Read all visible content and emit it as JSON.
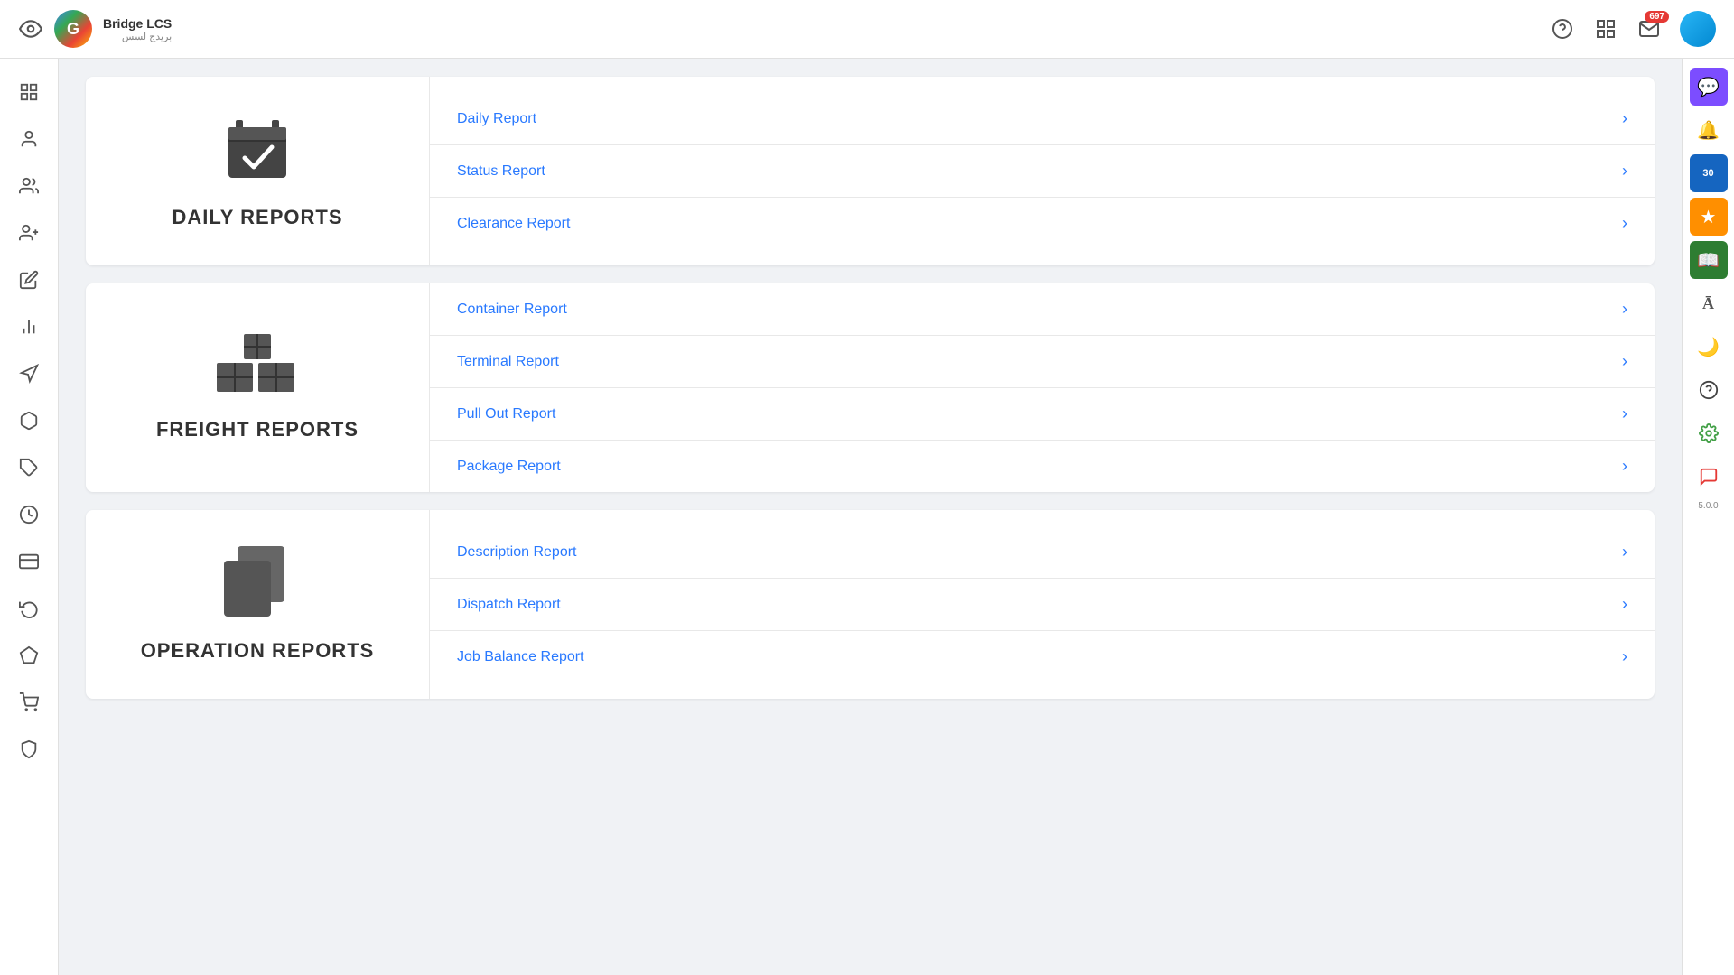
{
  "header": {
    "app_name": "Bridge LCS",
    "app_subtitle": "بريدج لسس",
    "logo_letter": "G",
    "badge_count": "697",
    "calendar_badge": "30"
  },
  "sidebar": {
    "items": [
      {
        "name": "grid-icon",
        "label": "Dashboard"
      },
      {
        "name": "user-icon",
        "label": "User"
      },
      {
        "name": "users-icon",
        "label": "Users"
      },
      {
        "name": "add-user-icon",
        "label": "Add User"
      },
      {
        "name": "edit-icon",
        "label": "Edit"
      },
      {
        "name": "chart-icon",
        "label": "Chart"
      },
      {
        "name": "location-icon",
        "label": "Location"
      },
      {
        "name": "cube-icon",
        "label": "Cube"
      },
      {
        "name": "tag-icon",
        "label": "Tag"
      },
      {
        "name": "clock-icon",
        "label": "Clock"
      },
      {
        "name": "card-icon",
        "label": "Card"
      },
      {
        "name": "refresh-icon",
        "label": "Refresh"
      },
      {
        "name": "diamond-icon",
        "label": "Diamond"
      },
      {
        "name": "cart-icon",
        "label": "Cart"
      },
      {
        "name": "shield-icon",
        "label": "Shield"
      }
    ]
  },
  "sections": [
    {
      "id": "daily-reports",
      "title": "DAILY REPORTS",
      "icon_type": "calendar-check",
      "items": [
        {
          "label": "Daily Report"
        },
        {
          "label": "Status Report"
        },
        {
          "label": "Clearance Report"
        }
      ]
    },
    {
      "id": "freight-reports",
      "title": "FREIGHT REPORTS",
      "icon_type": "boxes",
      "items": [
        {
          "label": "Container Report"
        },
        {
          "label": "Terminal Report"
        },
        {
          "label": "Pull Out Report"
        },
        {
          "label": "Package Report"
        }
      ]
    },
    {
      "id": "operation-reports",
      "title": "OPERATION REPORTS",
      "icon_type": "copy",
      "items": [
        {
          "label": "Description Report"
        },
        {
          "label": "Dispatch Report"
        },
        {
          "label": "Job Balance Report"
        }
      ]
    }
  ],
  "right_sidebar": {
    "version": "5.0.0"
  }
}
